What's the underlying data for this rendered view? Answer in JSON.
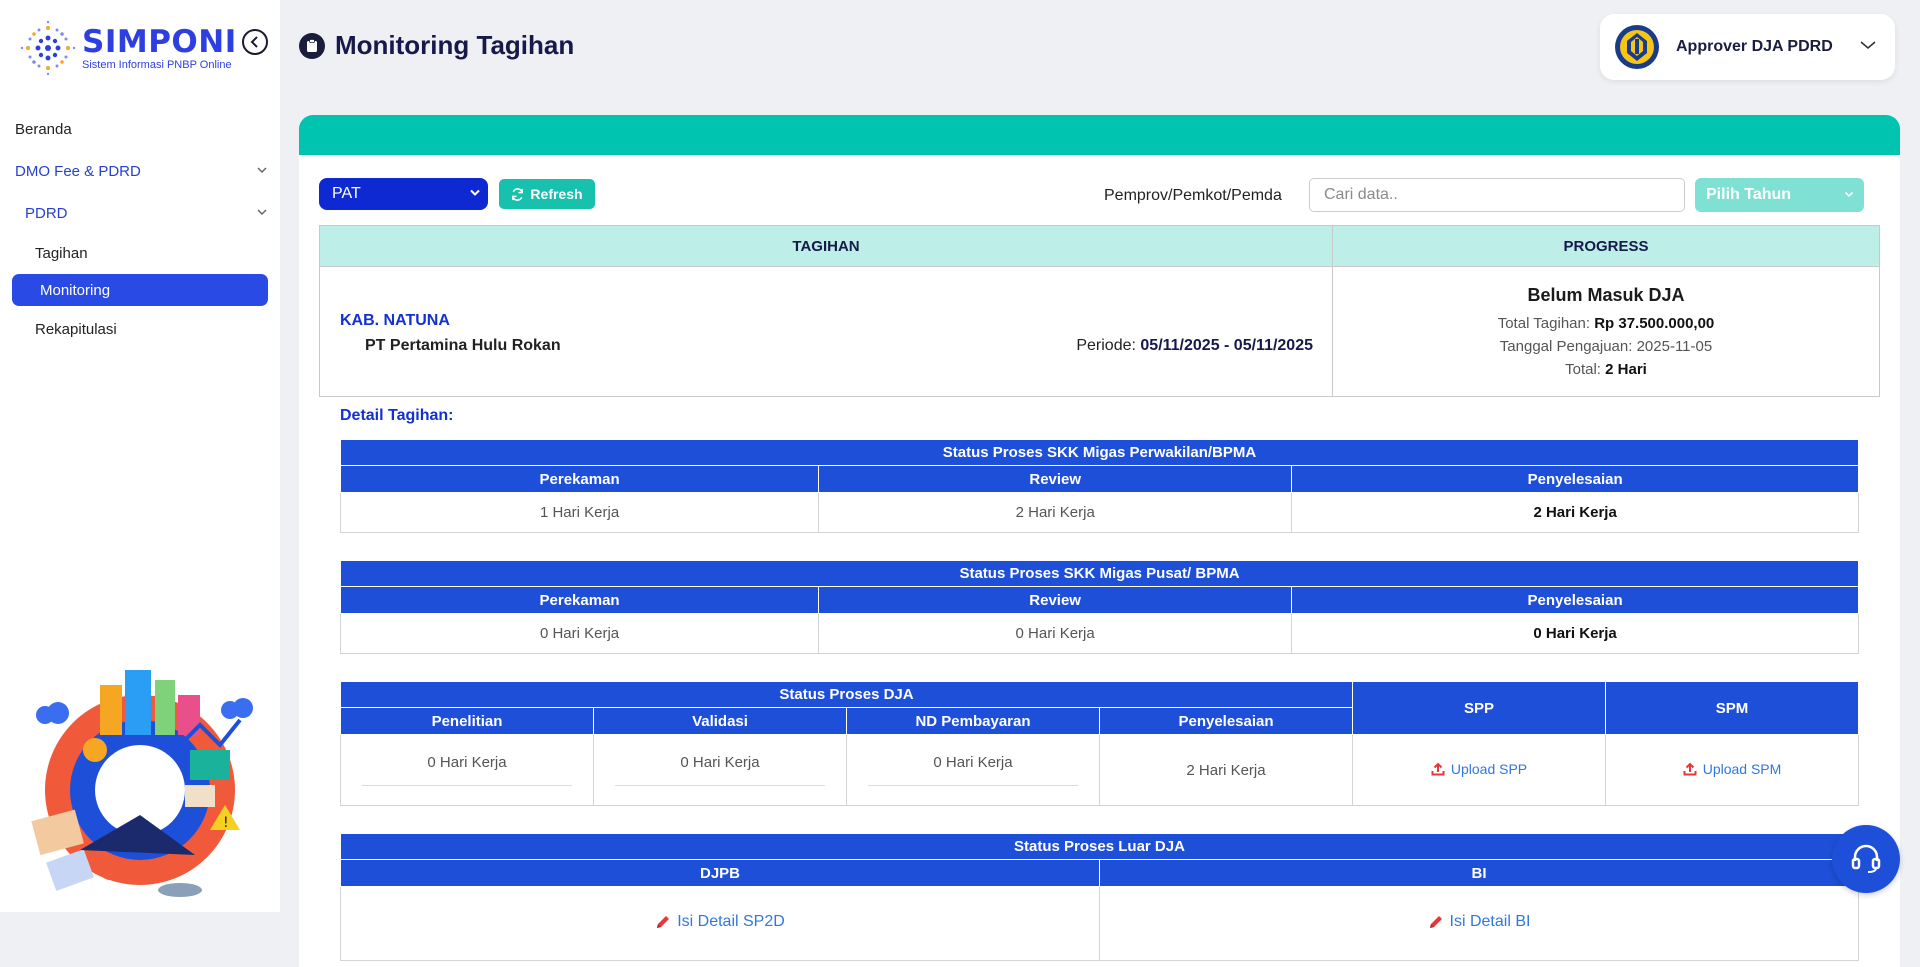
{
  "app": {
    "logo_title": "SIMPONI",
    "logo_subtitle": "Sistem Informasi PNBP Online"
  },
  "sidebar": {
    "items": [
      {
        "label": "Beranda"
      },
      {
        "label": "DMO Fee & PDRD"
      },
      {
        "label": "PDRD"
      },
      {
        "label": "Tagihan"
      },
      {
        "label": "Monitoring",
        "active": true
      },
      {
        "label": "Rekapitulasi"
      }
    ]
  },
  "header": {
    "title": "Monitoring Tagihan",
    "user_name": "Approver DJA PDRD"
  },
  "toolbar": {
    "type_value": "PAT",
    "refresh_label": "Refresh",
    "filter_label": "Pemprov/Pemkot/Pemda",
    "search_placeholder": "Cari data..",
    "year_placeholder": "Pilih Tahun"
  },
  "main_table": {
    "headers": {
      "tagihan": "TAGIHAN",
      "progress": "PROGRESS"
    },
    "region": "KAB. NATUNA",
    "company": "PT Pertamina Hulu Rokan",
    "periode_label": "Periode: ",
    "periode_value": "05/11/2025 - 05/11/2025",
    "progress": {
      "status": "Belum Masuk DJA",
      "total_tagihan_label": "Total Tagihan: ",
      "total_tagihan_value": "Rp 37.500.000,00",
      "tanggal_label": "Tanggal Pengajuan: ",
      "tanggal_value": "2025-11-05",
      "total_label": "Total: ",
      "total_value": "2 Hari"
    }
  },
  "detail_label": "Detail Tagihan:",
  "skk_perwakilan": {
    "title": "Status Proses SKK Migas Perwakilan/BPMA",
    "columns": [
      "Perekaman",
      "Review",
      "Penyelesaian"
    ],
    "values": [
      "1 Hari Kerja",
      "2 Hari Kerja",
      "2 Hari Kerja"
    ]
  },
  "skk_pusat": {
    "title": "Status Proses SKK Migas Pusat/ BPMA",
    "columns": [
      "Perekaman",
      "Review",
      "Penyelesaian"
    ],
    "values": [
      "0 Hari Kerja",
      "0 Hari Kerja",
      "0 Hari Kerja"
    ]
  },
  "dja": {
    "title": "Status Proses DJA",
    "columns": [
      "Penelitian",
      "Validasi",
      "ND Pembayaran",
      "Penyelesaian"
    ],
    "values": [
      "0 Hari Kerja",
      "0 Hari Kerja",
      "0 Hari Kerja",
      "2 Hari Kerja"
    ],
    "spp_header": "SPP",
    "spm_header": "SPM",
    "upload_spp": "Upload SPP",
    "upload_spm": "Upload SPM"
  },
  "luar_dja": {
    "title": "Status Proses Luar DJA",
    "columns": [
      "DJPB",
      "BI"
    ],
    "links": [
      "Isi Detail SP2D",
      "Isi Detail BI"
    ]
  },
  "colors": {
    "primary_blue": "#1e4fd8",
    "teal": "#00c4b0",
    "active_nav": "#2a4ae6"
  }
}
